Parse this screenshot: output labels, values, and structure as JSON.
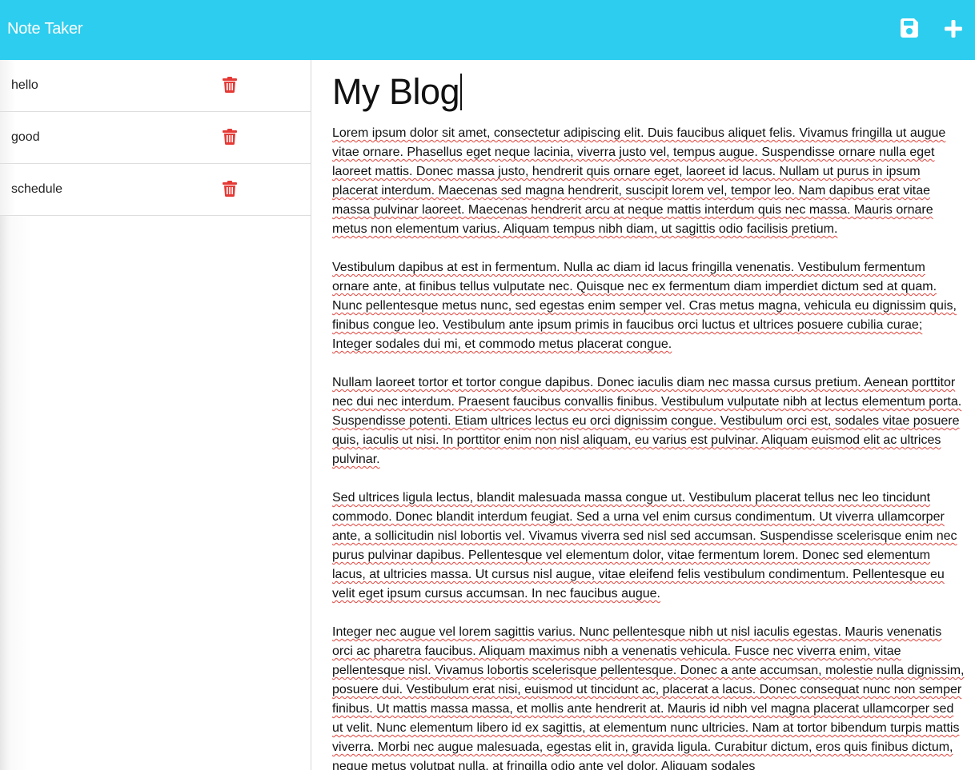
{
  "header": {
    "title": "Note Taker",
    "save_icon": "save-icon",
    "new_icon": "plus-icon",
    "background": "#2ccdee"
  },
  "sidebar": {
    "notes": [
      {
        "title": "hello",
        "delete_icon": "trash-icon"
      },
      {
        "title": "good",
        "delete_icon": "trash-icon"
      },
      {
        "title": "schedule",
        "delete_icon": "trash-icon"
      }
    ],
    "delete_color": "#e53935"
  },
  "editor": {
    "title": "My Blog",
    "paragraphs": [
      "Lorem ipsum dolor sit amet, consectetur adipiscing elit. Duis faucibus aliquet felis. Vivamus fringilla ut augue vitae ornare. Phasellus eget neque lacinia, viverra justo vel, tempus augue. Suspendisse ornare nulla eget laoreet mattis. Donec massa justo, hendrerit quis ornare eget, laoreet id lacus. Nullam ut purus in ipsum placerat interdum. Maecenas sed magna hendrerit, suscipit lorem vel, tempor leo. Nam dapibus erat vitae massa pulvinar laoreet. Maecenas hendrerit arcu at neque mattis interdum quis nec massa. Mauris ornare metus non elementum varius. Aliquam tempus nibh diam, ut sagittis odio facilisis pretium.",
      "Vestibulum dapibus at est in fermentum. Nulla ac diam id lacus fringilla venenatis. Vestibulum fermentum ornare ante, at finibus tellus vulputate nec. Quisque nec ex fermentum diam imperdiet dictum sed at quam. Nunc pellentesque metus nunc, sed egestas enim semper vel. Cras metus magna, vehicula eu dignissim quis, finibus congue leo. Vestibulum ante ipsum primis in faucibus orci luctus et ultrices posuere cubilia curae; Integer sodales dui mi, et commodo metus placerat congue.",
      "Nullam laoreet tortor et tortor congue dapibus. Donec iaculis diam nec massa cursus pretium. Aenean porttitor nec dui nec interdum. Praesent faucibus convallis finibus. Vestibulum vulputate nibh at lectus elementum porta. Suspendisse potenti. Etiam ultrices lectus eu orci dignissim congue. Vestibulum orci est, sodales vitae posuere quis, iaculis ut nisi. In porttitor enim non nisl aliquam, eu varius est pulvinar. Aliquam euismod elit ac ultrices pulvinar.",
      "Sed ultrices ligula lectus, blandit malesuada massa congue ut. Vestibulum placerat tellus nec leo tincidunt commodo. Donec blandit interdum feugiat. Sed a urna vel enim cursus condimentum. Ut viverra ullamcorper ante, a sollicitudin nisl lobortis vel. Vivamus viverra sed nisl sed accumsan. Suspendisse scelerisque enim nec purus pulvinar dapibus. Pellentesque vel elementum dolor, vitae fermentum lorem. Donec sed elementum lacus, at ultricies massa. Ut cursus nisl augue, vitae eleifend felis vestibulum condimentum. Pellentesque eu velit eget ipsum cursus accumsan. In nec faucibus augue.",
      "Integer nec augue vel lorem sagittis varius. Nunc pellentesque nibh ut nisl iaculis egestas. Mauris venenatis orci ac pharetra faucibus. Aliquam maximus nibh a venenatis vehicula. Fusce nec viverra enim, vitae pellentesque nisl. Vivamus lobortis scelerisque pellentesque. Donec a ante accumsan, molestie nulla dignissim, posuere dui. Vestibulum erat nisi, euismod ut tincidunt ac, placerat a lacus. Donec consequat nunc non semper finibus. Ut mattis massa massa, et mollis ante hendrerit at. Mauris id nibh vel magna placerat ullamcorper sed ut velit. Nunc elementum libero id ex sagittis, at elementum nunc ultricies. Nam at tortor bibendum turpis mattis viverra. Morbi nec augue malesuada, egestas elit in, gravida ligula. Curabitur dictum, eros quis finibus dictum, neque metus volutpat nulla, at fringilla odio ante vel dolor. Aliquam sodales"
    ]
  }
}
